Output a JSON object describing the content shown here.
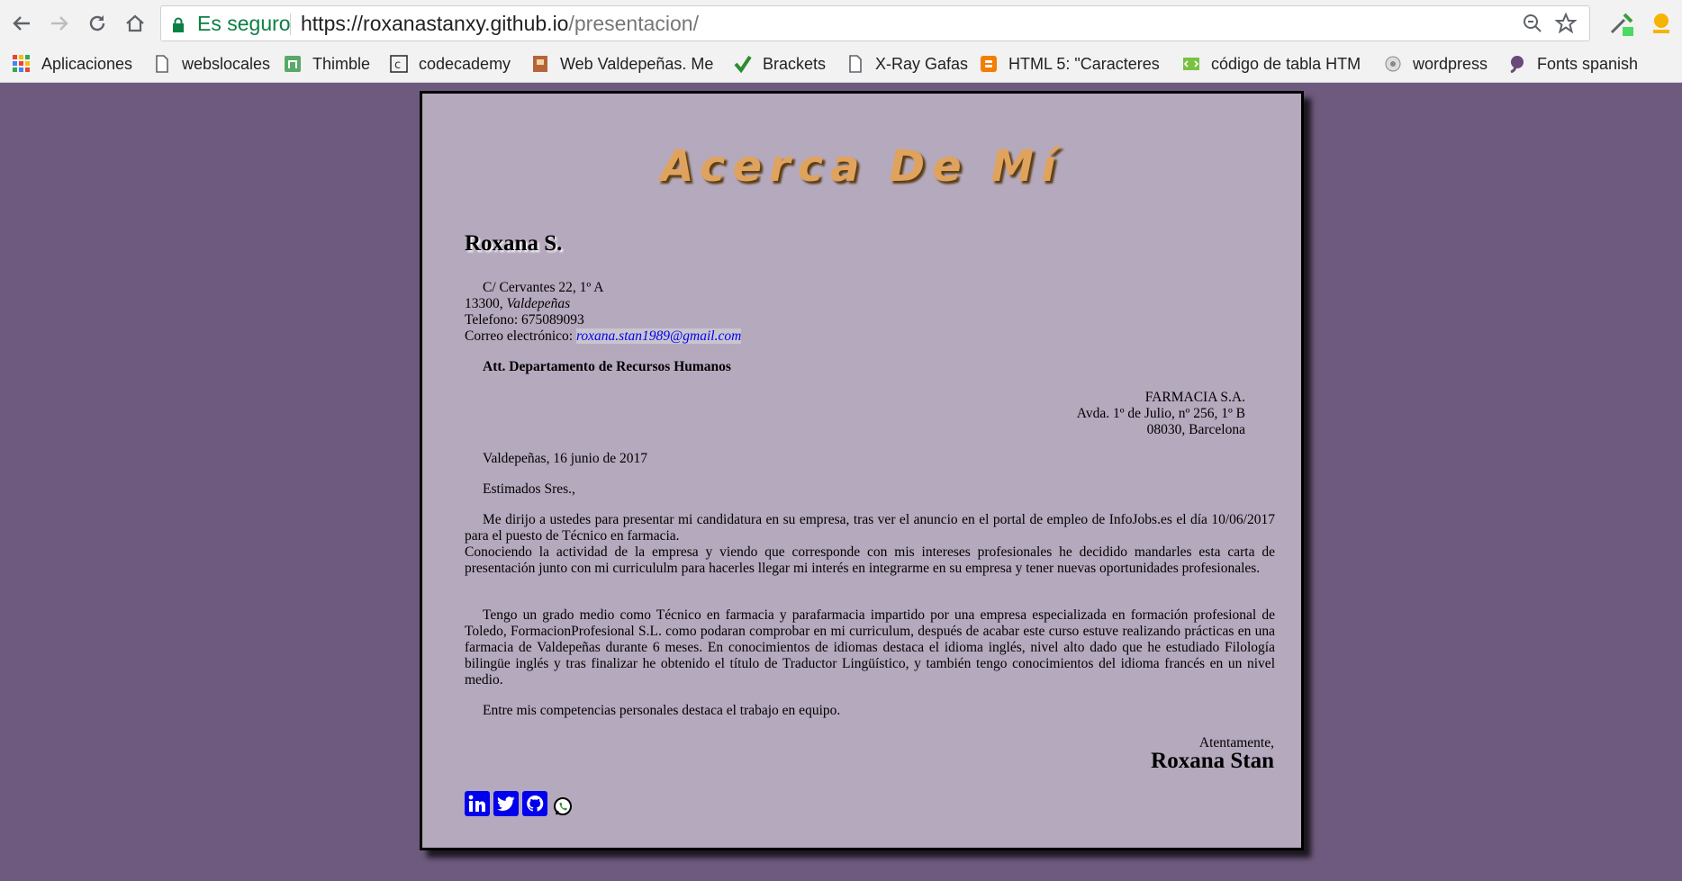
{
  "browser": {
    "security_label": "Es seguro",
    "url_host": "https://roxanastanxy.github.io",
    "url_path": "/presentacion/"
  },
  "bookmarks": [
    {
      "label": "Aplicaciones",
      "icon": "apps-grid-icon"
    },
    {
      "label": "webslocales",
      "icon": "page-icon"
    },
    {
      "label": "Thimble",
      "icon": "thimble-icon"
    },
    {
      "label": "codecademy",
      "icon": "codecademy-icon"
    },
    {
      "label": "Web Valdepeñas. Me",
      "icon": "bookmark-site-icon"
    },
    {
      "label": "Brackets",
      "icon": "checkmark-icon"
    },
    {
      "label": "X-Ray Gafas",
      "icon": "page-icon"
    },
    {
      "label": "HTML 5: \"Caracteres",
      "icon": "blogger-icon"
    },
    {
      "label": "código de tabla HTM",
      "icon": "table-code-icon"
    },
    {
      "label": "wordpress",
      "icon": "wordpress-icon"
    },
    {
      "label": "Fonts spanish",
      "icon": "fonts-icon"
    }
  ],
  "letter": {
    "title": "Acerca De Mí",
    "name": "Roxana S.",
    "address": {
      "street": "C/ Cervantes 22, 1º A",
      "postal_code": "13300, ",
      "city": "Valdepeñas",
      "phone": "Telefono: 675089093",
      "email_label": "Correo electrónico: ",
      "email": "roxana.stan1989@gmail.com"
    },
    "attention": "Att. Departamento de Recursos Humanos",
    "recipient": {
      "company": "FARMACIA S.A.",
      "street": "Avda. 1º de Julio, nº 256, 1º B",
      "city": "08030, Barcelona"
    },
    "date": "Valdepeñas, 16 junio de 2017",
    "greeting": "Estimados Sres.,",
    "paragraph1": "Me dirijo a ustedes para presentar mi candidatura en su empresa, tras ver el anuncio en el portal de empleo de InfoJobs.es el día 10/06/2017 para el puesto de Técnico en farmacia.",
    "paragraph2": "Conociendo la actividad de la empresa y viendo que corresponde con mis intereses profesionales he decidido mandarles esta carta de presentación junto con mi curricululm para hacerles llegar mi interés en integrarme en su empresa y tener nuevas oportunidades profesionales.",
    "paragraph3": "Tengo un grado medio como Técnico en farmacia y parafarmacia impartido por una empresa especializada en formación profesional de Toledo, FormacionProfesional S.L. como podaran comprobar en mi curriculum, después de acabar este curso estuve realizando prácticas en una farmacia de Valdepeñas durante 6 meses. En conocimientos de idiomas destaca el idioma inglés, nivel alto dado que he estudiado Filología bilingüe inglés y tras finalizar he obtenido el título de Traductor Lingüístico, y también tengo conocimientos del idioma francés en un nivel medio.",
    "paragraph4": "Entre mis competencias personales destaca el trabajo en equipo.",
    "closing": "Atentamente,",
    "signature": "Roxana Stan"
  },
  "colors": {
    "page_background": "#6e5a7e",
    "letter_background": "#b5a9bd",
    "title": "#e0a35e",
    "link": "#0000ee",
    "secure": "#0b8043"
  }
}
